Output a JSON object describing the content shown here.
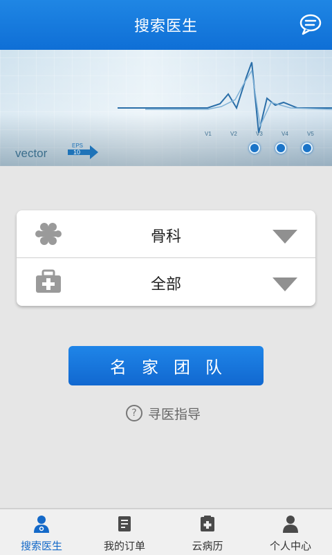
{
  "header": {
    "title": "搜索医生",
    "icon": "chat-bubble-icon"
  },
  "banner": {
    "brand_text": "vector",
    "eps_label": "EPS",
    "eps_number": "10",
    "axis_labels": [
      "V1",
      "V2",
      "V3",
      "V4",
      "V5"
    ],
    "slides": 3,
    "active_slide": 2
  },
  "filters": {
    "department": {
      "value": "骨科",
      "icon": "bone-icon"
    },
    "category": {
      "value": "全部",
      "icon": "medical-kit-icon"
    }
  },
  "team_button": {
    "label": "名家团队"
  },
  "guide": {
    "label": "寻医指导"
  },
  "tabbar": {
    "items": [
      {
        "label": "搜索医生",
        "icon": "doctor-icon",
        "active": true
      },
      {
        "label": "我的订单",
        "icon": "document-icon",
        "active": false
      },
      {
        "label": "云病历",
        "icon": "medical-record-icon",
        "active": false
      },
      {
        "label": "个人中心",
        "icon": "person-icon",
        "active": false
      }
    ]
  },
  "colors": {
    "primary": "#1b76d8",
    "active_tab": "#1469c8",
    "background": "#e6e6e6"
  }
}
